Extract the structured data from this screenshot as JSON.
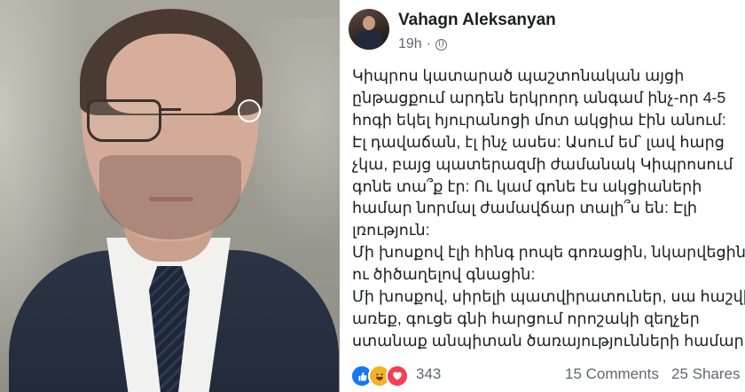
{
  "post": {
    "author": "Vahagn Aleksanyan",
    "time": "19h",
    "body": [
      "Կիպրոս կատարած պաշտոնական այցի",
      "ընթացքում արդեն երկրորդ անգամ ինչ-որ 4-5",
      "հոգի եկել հյուրանոցի մոտ ակցիա էին անում:",
      "Էլ դավաճան, էլ ինչ ասես: Ասում եմ՝ լավ հարց",
      "չկա, բայց պատերազմի ժամանակ Կիպրոսում",
      "գոնե տա՞ք էր: Ու կամ գոնե էս ակցիաների",
      "համար նորմալ ժամավճար տալի՞ս են: Էլի",
      "լռություն:",
      "Մի խոսքով էլի հինգ րոպե գոռացին, նկարվեցին",
      "ու ծիծաղելով գնացին:",
      "Մի խոսքով, սիրելի պատվիրատուներ, սա հաշվի",
      "առեք, գուցե գնի հարցում որոշակի զեղչեր",
      "ստանաք անպիտան ծառայությունների համար:"
    ],
    "reactions": {
      "icons": [
        "like-icon",
        "haha-icon",
        "love-icon"
      ],
      "count": "343"
    },
    "comments": "15 Comments",
    "shares": "25 Shares"
  },
  "colors": {
    "like": "#1877f2",
    "haha": "#f7b125",
    "love": "#f33e58",
    "text": "#1c1e21",
    "meta": "#606770"
  }
}
